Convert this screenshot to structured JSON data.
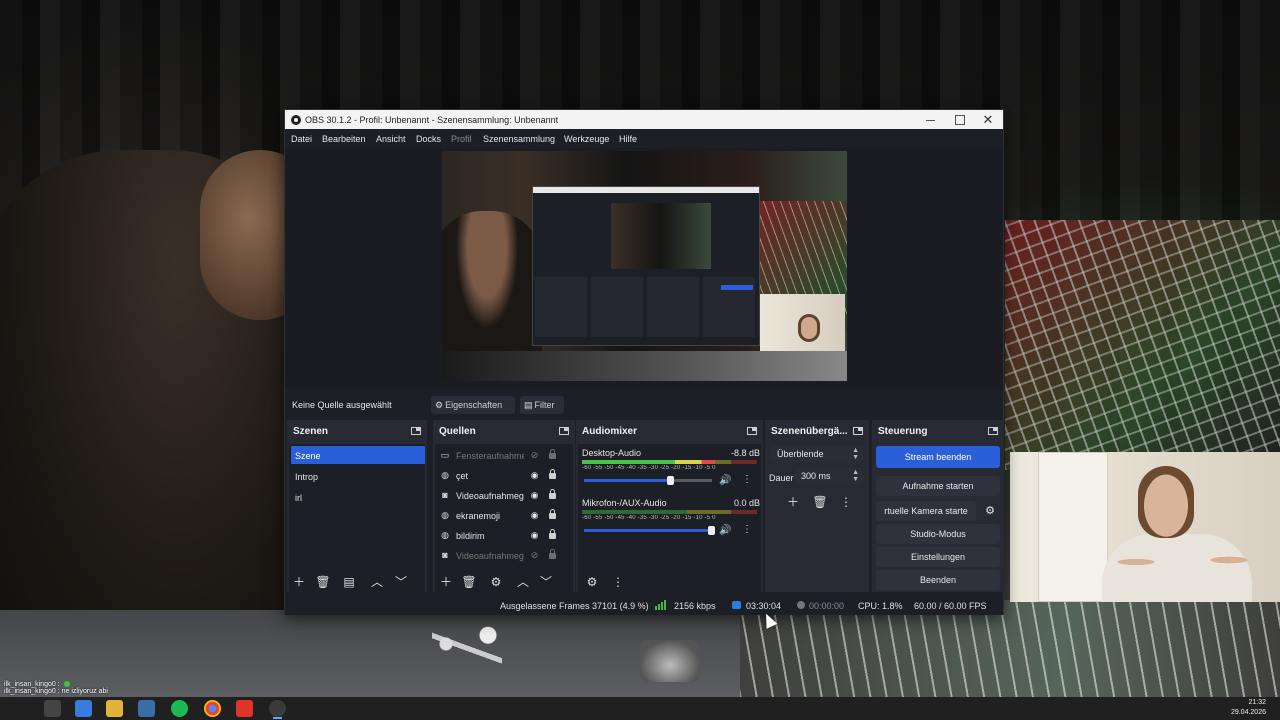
{
  "window": {
    "title": "OBS 30.1.2 - Profil: Unbenannt - Szenensammlung: Unbenannt"
  },
  "menu": [
    {
      "label": "Datei",
      "enabled": true
    },
    {
      "label": "Bearbeiten",
      "enabled": true
    },
    {
      "label": "Ansicht",
      "enabled": true
    },
    {
      "label": "Docks",
      "enabled": true
    },
    {
      "label": "Profil",
      "enabled": false
    },
    {
      "label": "Szenensammlung",
      "enabled": true
    },
    {
      "label": "Werkzeuge",
      "enabled": true
    },
    {
      "label": "Hilfe",
      "enabled": true
    }
  ],
  "source_bar": {
    "status": "Keine Quelle ausgewählt",
    "properties_label": "Eigenschaften",
    "filter_label": "Filter"
  },
  "scenes": {
    "title": "Szenen",
    "items": [
      {
        "label": "Szene",
        "active": true
      },
      {
        "label": "Introp",
        "active": false
      },
      {
        "label": "irl",
        "active": false
      }
    ]
  },
  "sources": {
    "title": "Quellen",
    "items": [
      {
        "label": "Fensteraufnahme",
        "icon": "window-icon",
        "visible": false
      },
      {
        "label": "çet",
        "icon": "globe-icon",
        "visible": true
      },
      {
        "label": "Videoaufnahmegerät",
        "icon": "camera-icon",
        "visible": true
      },
      {
        "label": "ekranemoji",
        "icon": "globe-icon",
        "visible": true
      },
      {
        "label": "bildirim",
        "icon": "globe-icon",
        "visible": true
      },
      {
        "label": "Videoaufnahmegerät",
        "icon": "camera-icon",
        "visible": false
      }
    ]
  },
  "mixer": {
    "title": "Audiomixer",
    "channels": [
      {
        "name": "Desktop-Audio",
        "db": "-8.8 dB",
        "level": 0.76,
        "volume": 0.68
      },
      {
        "name": "Mikrofon-/AUX-Audio",
        "db": "0.0 dB",
        "level": 0.0,
        "volume": 1.0
      }
    ],
    "scale": "-60 -55 -50 -45 -40 -35 -30 -25 -20 -15 -10 -5 0"
  },
  "transitions": {
    "title": "Szenenübergä...",
    "selected": "Überblende",
    "duration_label": "Dauer",
    "duration_value": "300 ms"
  },
  "controls": {
    "title": "Steuerung",
    "stream_button": "Stream beenden",
    "record_button": "Aufnahme starten",
    "virtual_cam_button": "rtuelle Kamera starte",
    "studio_button": "Studio-Modus",
    "settings_button": "Einstellungen",
    "exit_button": "Beenden"
  },
  "status": {
    "dropped_frames": "Ausgelassene Frames 37101 (4.9 %)",
    "bitrate": "2156 kbps",
    "stream_time": "03:30:04",
    "record_time": "00:00:00",
    "cpu": "CPU: 1.8%",
    "fps": "60.00 / 60.00 FPS"
  },
  "chat": [
    {
      "user": "ilk_insan_kingo0",
      "message": ""
    },
    {
      "user": "ilk_insan_kingo0",
      "message": "ne izliyoruz abi"
    }
  ],
  "taskbar": {
    "time": "21:32",
    "date": "29.04.2026"
  },
  "colors": {
    "accent": "#2b5fd9",
    "window_bg": "#1d1f26",
    "dock_header_bg": "#272a33"
  }
}
